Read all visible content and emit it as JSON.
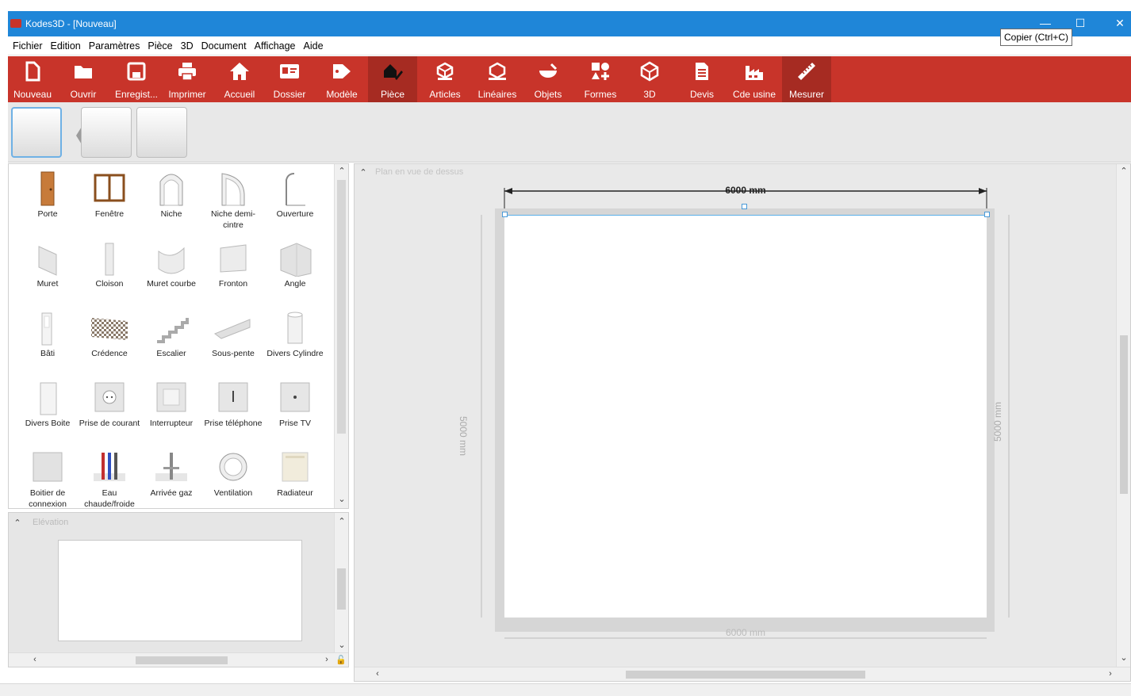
{
  "window": {
    "title": "Kodes3D - [Nouveau]",
    "minimize": "—",
    "maximize": "☐",
    "close": "✕"
  },
  "tooltip": "Copier (Ctrl+C)",
  "menu": [
    "Fichier",
    "Edition",
    "Paramètres",
    "Pièce",
    "3D",
    "Document",
    "Affichage",
    "Aide"
  ],
  "toolbar": {
    "nouveau": "Nouveau",
    "ouvrir": "Ouvrir",
    "enregistrer": "Enregist...",
    "imprimer": "Imprimer",
    "accueil": "Accueil",
    "dossier": "Dossier",
    "modele": "Modèle",
    "piece": "Pièce",
    "articles": "Articles",
    "lineaires": "Linéaires",
    "objets": "Objets",
    "formes": "Formes",
    "3d": "3D",
    "devis": "Devis",
    "cde_usine": "Cde usine",
    "mesurer": "Mesurer"
  },
  "catalog": {
    "items": [
      [
        "Porte",
        "Fenêtre",
        "Niche",
        "Niche demi-cintre",
        "Ouverture"
      ],
      [
        "Muret",
        "Cloison",
        "Muret courbe",
        "Fronton",
        "Angle"
      ],
      [
        "Bâti",
        "Crédence",
        "Escalier",
        "Sous-pente",
        "Divers Cylindre"
      ],
      [
        "Divers Boite",
        "Prise de courant",
        "Interrupteur",
        "Prise téléphone",
        "Prise TV"
      ],
      [
        "Boitier de connexion",
        "Eau chaude/froide",
        "Arrivée gaz",
        "Ventilation",
        "Radiateur"
      ]
    ]
  },
  "elevation": {
    "title": "Elévation"
  },
  "plan": {
    "title": "Plan en vue de dessus",
    "dim_top": "6000 mm",
    "dim_bottom": "6000 mm",
    "dim_left": "5000 mm",
    "dim_right": "5000 mm"
  },
  "colors": {
    "titlebar": "#1f86d8",
    "toolbar": "#c8342a",
    "toolbar_active": "#a62b22",
    "selection": "#5aaee8"
  }
}
